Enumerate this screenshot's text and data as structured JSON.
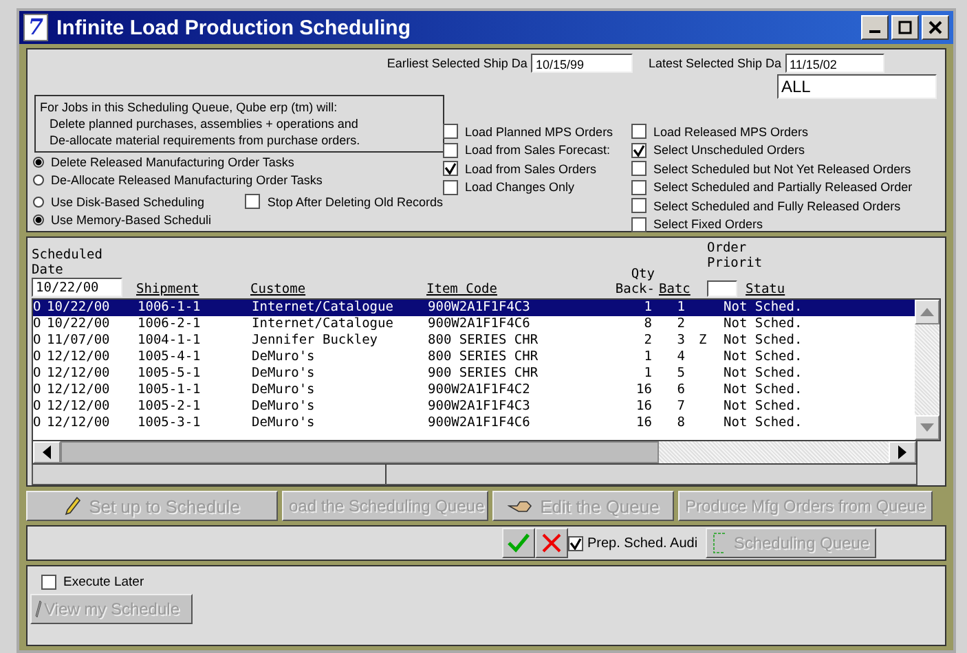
{
  "window": {
    "title": "Infinite Load Production Scheduling",
    "app_icon": "7"
  },
  "ship_dates": {
    "earliest_label": "Earliest Selected Ship Da",
    "earliest_value": "10/15/99",
    "latest_label": "Latest Selected Ship Da",
    "latest_value": "11/15/02",
    "filter_value": "ALL"
  },
  "info_box": [
    "For Jobs in this Scheduling Queue, Qube erp (tm) will:",
    "Delete planned purchases, assemblies + operations and",
    "De-allocate material requirements from purchase orders."
  ],
  "task_options": [
    {
      "label": "Delete Released Manufacturing Order Tasks",
      "selected": true
    },
    {
      "label": "De-Allocate Released Manufacturing Order Tasks",
      "selected": false
    }
  ],
  "scheduling_options": [
    {
      "label": "Use Disk-Based Scheduling",
      "selected": false
    },
    {
      "label": "Use Memory-Based Scheduli",
      "selected": true
    }
  ],
  "stop_after_deleting": {
    "label": "Stop After Deleting Old Records",
    "checked": false
  },
  "load_options": [
    {
      "label": "Load Planned MPS Orders",
      "checked": false
    },
    {
      "label": "Load from Sales Forecast:",
      "checked": false
    },
    {
      "label": "Load from Sales Orders",
      "checked": true
    },
    {
      "label": "Load Changes Only",
      "checked": false
    }
  ],
  "select_options": [
    {
      "label": "Load Released MPS Orders",
      "checked": false
    },
    {
      "label": "Select Unscheduled Orders",
      "checked": true
    },
    {
      "label": "Select Scheduled but Not Yet Released Orders",
      "checked": false
    },
    {
      "label": "Select Scheduled and Partially Released Order",
      "checked": false
    },
    {
      "label": "Select Scheduled and Fully Released Orders",
      "checked": false
    },
    {
      "label": "Select Fixed Orders",
      "checked": false
    }
  ],
  "table": {
    "date_heading": [
      "Scheduled",
      "Date"
    ],
    "date_filter": "10/22/00",
    "columns": [
      "Shipment",
      "Custome",
      "Item Code",
      "Qty Back-",
      "Batc",
      "Order Priorit",
      "Statu"
    ],
    "rows": [
      {
        "flag": "O",
        "date": "10/22/00",
        "shipment": "1006-1-1",
        "customer": "Internet/Catalogue",
        "item_code": "900W2A1F1F4C3",
        "qty": "1",
        "batch": "1",
        "priority": "",
        "status": "Not Sched.",
        "selected": true
      },
      {
        "flag": "O",
        "date": "10/22/00",
        "shipment": "1006-2-1",
        "customer": "Internet/Catalogue",
        "item_code": "900W2A1F1F4C6",
        "qty": "8",
        "batch": "2",
        "priority": "",
        "status": "Not Sched.",
        "selected": false
      },
      {
        "flag": "O",
        "date": "11/07/00",
        "shipment": "1004-1-1",
        "customer": "Jennifer Buckley",
        "item_code": "800 SERIES CHR",
        "qty": "2",
        "batch": "3",
        "priority": "Z",
        "status": "Not Sched.",
        "selected": false
      },
      {
        "flag": "O",
        "date": "12/12/00",
        "shipment": "1005-4-1",
        "customer": "DeMuro's",
        "item_code": "800 SERIES CHR",
        "qty": "1",
        "batch": "4",
        "priority": "",
        "status": "Not Sched.",
        "selected": false
      },
      {
        "flag": "O",
        "date": "12/12/00",
        "shipment": "1005-5-1",
        "customer": "DeMuro's",
        "item_code": "900 SERIES CHR",
        "qty": "1",
        "batch": "5",
        "priority": "",
        "status": "Not Sched.",
        "selected": false
      },
      {
        "flag": "O",
        "date": "12/12/00",
        "shipment": "1005-1-1",
        "customer": "DeMuro's",
        "item_code": "900W2A1F1F4C2",
        "qty": "16",
        "batch": "6",
        "priority": "",
        "status": "Not Sched.",
        "selected": false
      },
      {
        "flag": "O",
        "date": "12/12/00",
        "shipment": "1005-2-1",
        "customer": "DeMuro's",
        "item_code": "900W2A1F1F4C3",
        "qty": "16",
        "batch": "7",
        "priority": "",
        "status": "Not Sched.",
        "selected": false
      },
      {
        "flag": "O",
        "date": "12/12/00",
        "shipment": "1005-3-1",
        "customer": "DeMuro's",
        "item_code": "900W2A1F1F4C6",
        "qty": "16",
        "batch": "8",
        "priority": "",
        "status": "Not Sched.",
        "selected": false
      }
    ]
  },
  "actions": [
    {
      "label": "Set up to Schedule",
      "kind": "pencil",
      "disabled": true
    },
    {
      "label": "oad the Scheduling Queue",
      "kind": "plain",
      "disabled": true
    },
    {
      "label": "Edit the Queue",
      "kind": "hand",
      "disabled": true
    },
    {
      "label": "Produce Mfg Orders from Queue",
      "kind": "plain",
      "disabled": true
    }
  ],
  "prep_audit": {
    "label": "Prep. Sched. Audi",
    "checked": true
  },
  "queue_button": {
    "label": "Scheduling Queue",
    "disabled": true
  },
  "execute_later": {
    "label": "Execute Later",
    "checked": false
  },
  "view_button": {
    "label": "View my Schedule",
    "disabled": true
  }
}
